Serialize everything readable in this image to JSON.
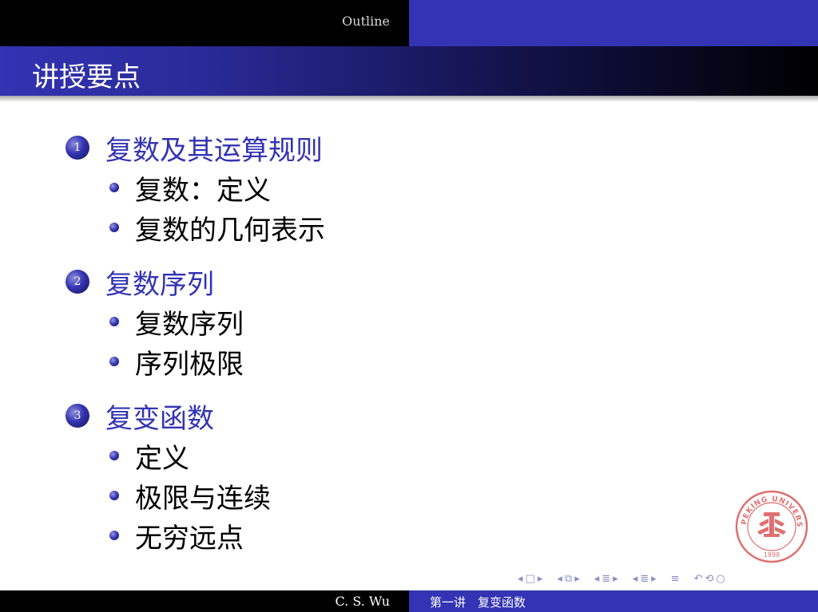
{
  "header": {
    "section_label": "Outline"
  },
  "frame": {
    "title": "讲授要点"
  },
  "sections": [
    {
      "number": "1",
      "title": "复数及其运算规则",
      "items": [
        "复数：定义",
        "复数的几何表示"
      ]
    },
    {
      "number": "2",
      "title": "复数序列",
      "items": [
        "复数序列",
        "序列极限"
      ]
    },
    {
      "number": "3",
      "title": "复变函数",
      "items": [
        "定义",
        "极限与连续",
        "无穷远点"
      ]
    }
  ],
  "seal": {
    "text": "PEKING UNIVERSITY",
    "year": "1898"
  },
  "nav": {
    "icons": [
      "nav-frame-icon",
      "nav-subsection-icon",
      "nav-section-icon",
      "nav-subsection-arrows-icon",
      "nav-align-icon",
      "nav-search-icon"
    ]
  },
  "footer": {
    "author": "C. S. Wu",
    "title": "第一讲　复变函数"
  },
  "colors": {
    "structure": "#3333b3",
    "dark": "#000000",
    "text_light": "#ffffff"
  }
}
